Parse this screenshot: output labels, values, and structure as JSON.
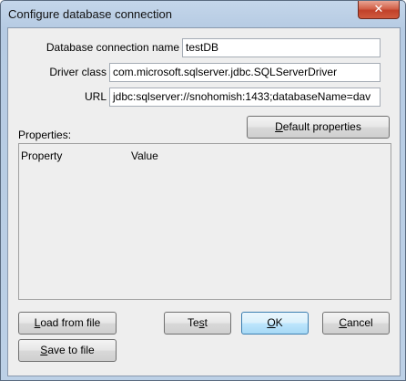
{
  "window": {
    "title": "Configure database connection",
    "close_glyph": "✕"
  },
  "form": {
    "name_label": "Database connection name",
    "name_value": "testDB",
    "driver_label": "Driver class",
    "driver_value": "com.microsoft.sqlserver.jdbc.SQLServerDriver",
    "url_label": "URL",
    "url_value": "jdbc:sqlserver://snohomish:1433;databaseName=dav"
  },
  "buttons": {
    "default_props": {
      "first": "D",
      "rest": "efault properties"
    },
    "load": {
      "first": "L",
      "rest": "oad from file"
    },
    "save": {
      "first": "S",
      "rest": "ave to file"
    },
    "test": {
      "pre": "Te",
      "mnemonic": "s",
      "post": "t"
    },
    "ok": {
      "first": "O",
      "rest": "K"
    },
    "cancel": {
      "first": "C",
      "rest": "ancel"
    }
  },
  "properties": {
    "label": "Properties:",
    "columns": [
      "Property",
      "Value"
    ]
  }
}
